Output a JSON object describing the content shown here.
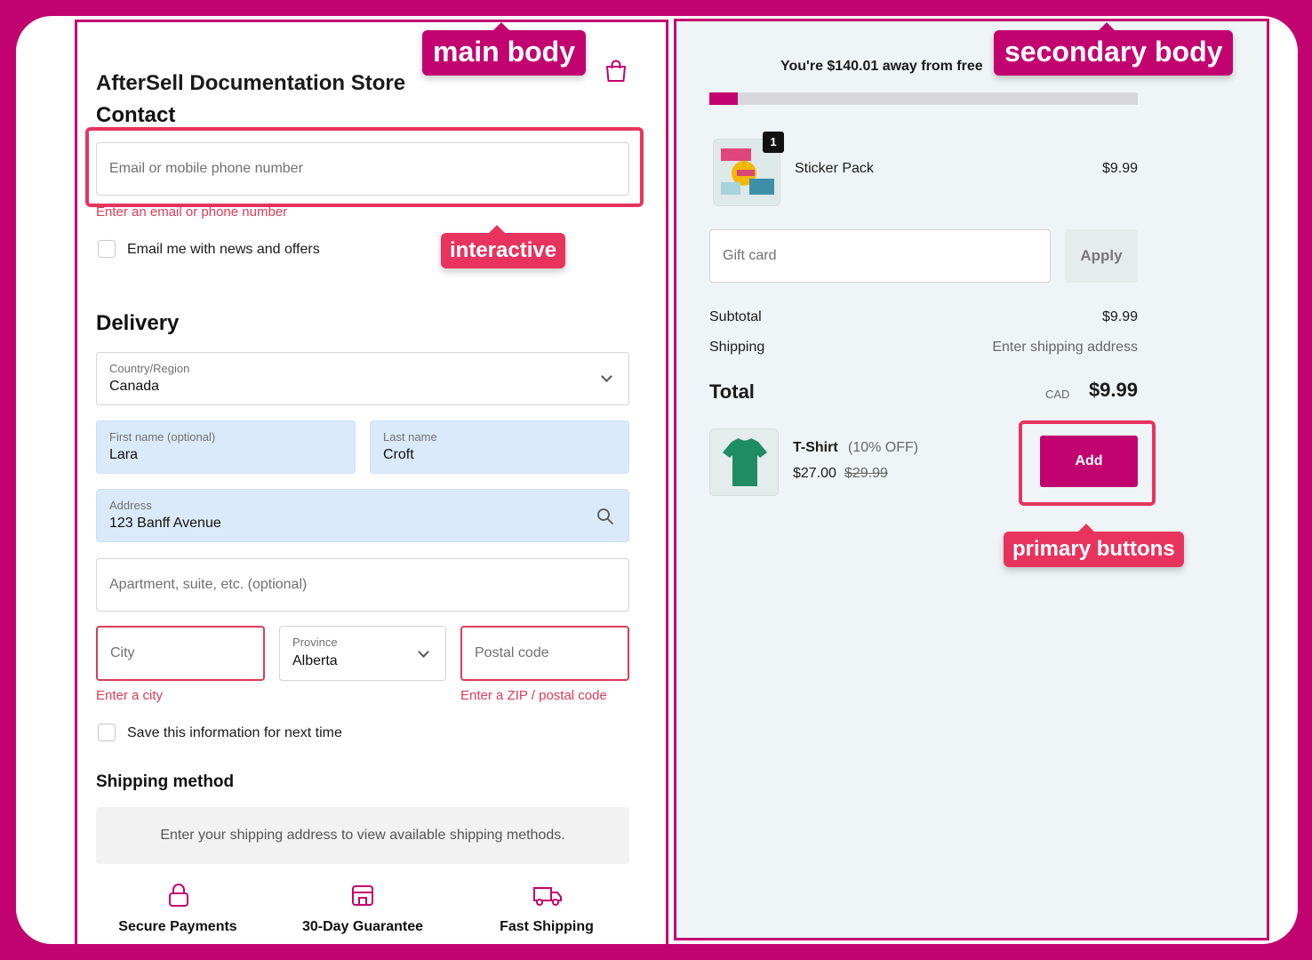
{
  "store": {
    "title": "AfterSell Documentation Store",
    "cart_icon": "shopping-bag-icon"
  },
  "contact": {
    "heading": "Contact",
    "email_placeholder": "Email or mobile phone number",
    "email_error": "Enter an email or phone number",
    "newsletter_label": "Email me with news and offers"
  },
  "delivery": {
    "heading": "Delivery",
    "country_label": "Country/Region",
    "country_value": "Canada",
    "first_name_label": "First name (optional)",
    "first_name_value": "Lara",
    "last_name_label": "Last name",
    "last_name_value": "Croft",
    "address_label": "Address",
    "address_value": "123 Banff Avenue",
    "apartment_placeholder": "Apartment, suite, etc. (optional)",
    "city_placeholder": "City",
    "city_error": "Enter a city",
    "province_label": "Province",
    "province_value": "Alberta",
    "postal_placeholder": "Postal code",
    "postal_error": "Enter a ZIP / postal code",
    "save_label": "Save this information for next time"
  },
  "shipping_method": {
    "heading": "Shipping method",
    "note": "Enter your shipping address to view available shipping methods."
  },
  "trust": {
    "secure": "Secure Payments",
    "guarantee": "30-Day Guarantee",
    "fast": "Fast Shipping"
  },
  "summary": {
    "free_shipping_text": "You're $140.01 away from free",
    "progress_fraction": 0.066,
    "item_name": "Sticker Pack",
    "item_price": "$9.99",
    "item_qty": "1",
    "gift_placeholder": "Gift card",
    "apply_label": "Apply",
    "subtotal_label": "Subtotal",
    "subtotal_value": "$9.99",
    "shipping_label": "Shipping",
    "shipping_value": "Enter shipping address",
    "total_label": "Total",
    "total_currency": "CAD",
    "total_value": "$9.99"
  },
  "upsell": {
    "name": "T-Shirt",
    "discount": "(10% OFF)",
    "price": "$27.00",
    "old_price": "$29.99",
    "add_label": "Add"
  },
  "annotations": {
    "main_body": "main body",
    "secondary_body": "secondary body",
    "interactive": "interactive",
    "primary_buttons": "primary buttons"
  },
  "colors": {
    "brand": "#c2026f",
    "annotation": "#e8335f",
    "error": "#d93d5a"
  }
}
